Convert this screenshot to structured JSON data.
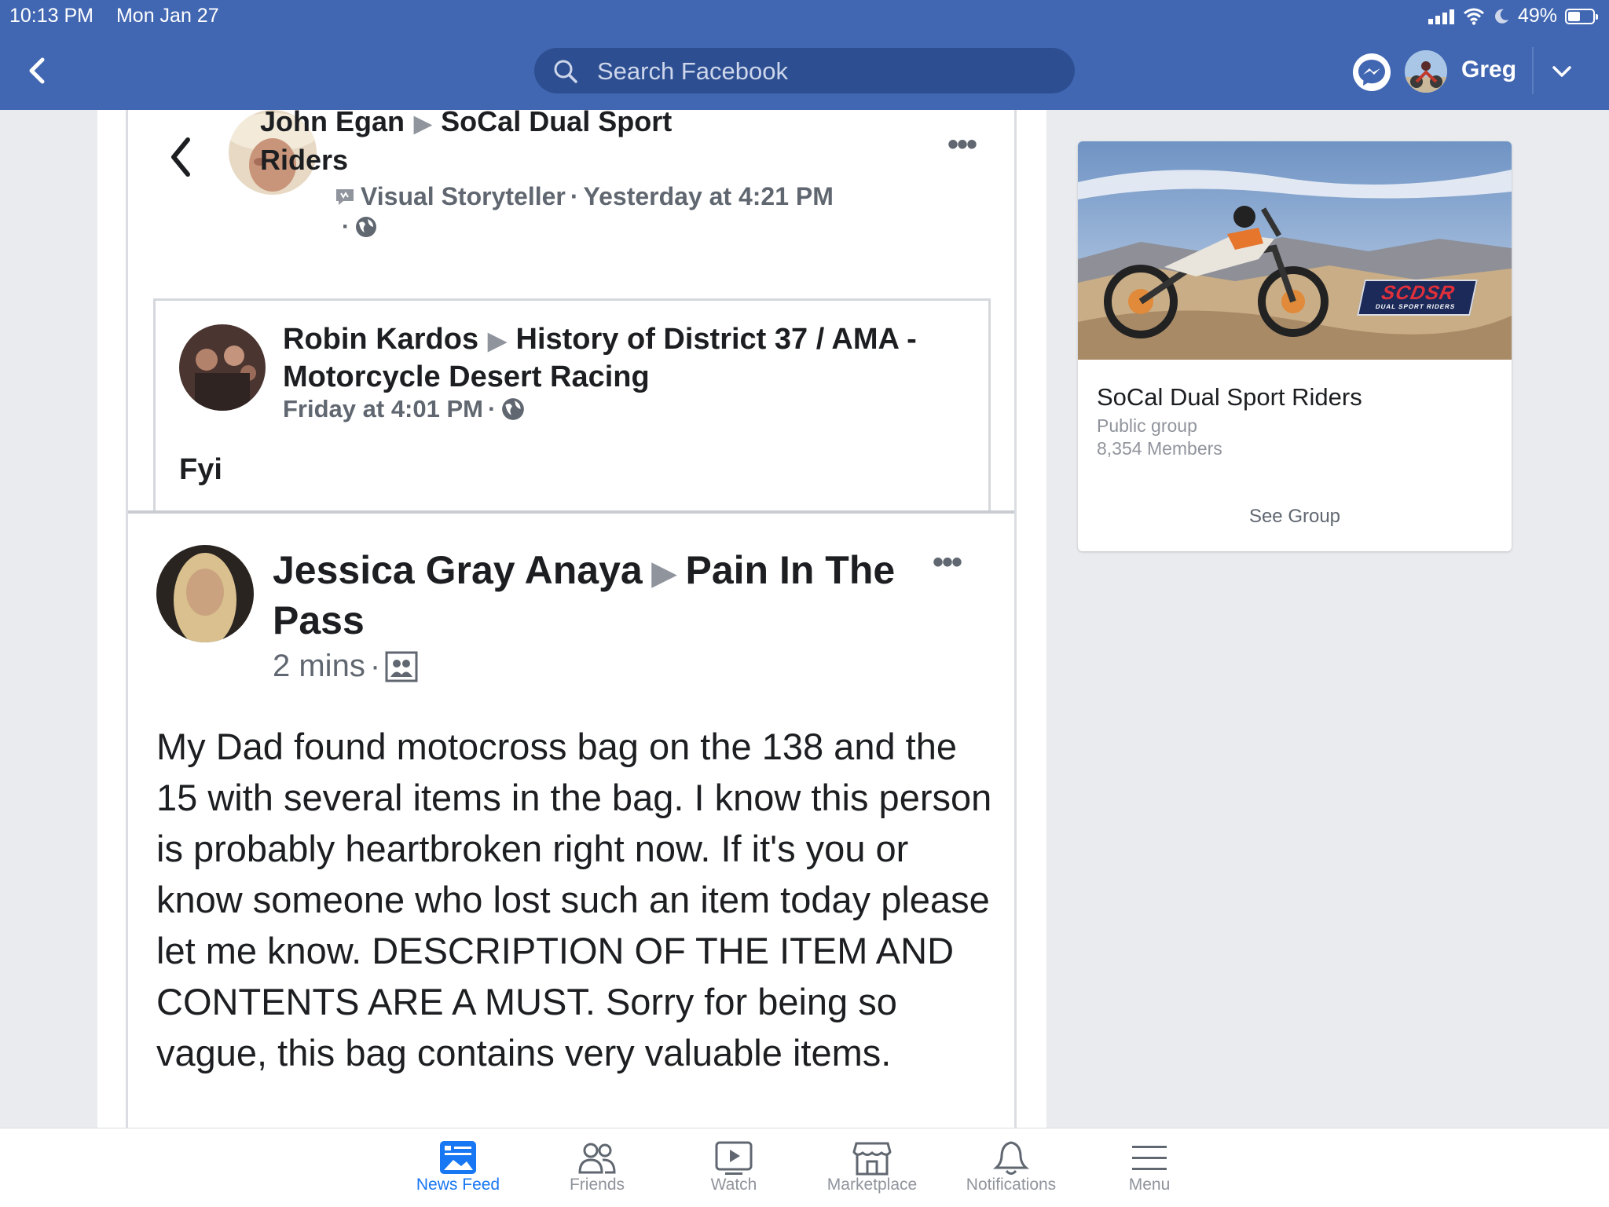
{
  "status_bar": {
    "time": "10:13 PM",
    "date": "Mon Jan 27",
    "battery": "49%",
    "battery_level": 0.49
  },
  "header": {
    "search_placeholder": "Search Facebook",
    "user_name": "Greg"
  },
  "shared_post": {
    "author": "John Egan",
    "group": "SoCal Dual Sport Riders",
    "badge": "Visual Storyteller",
    "time": "Yesterday at 4:21 PM",
    "quoted": {
      "author": "Robin Kardos",
      "group": "History of District 37 / AMA - Motorcycle Desert Racing",
      "time": "Friday at 4:01 PM",
      "text": "Fyi"
    }
  },
  "post": {
    "author": "Jessica Gray Anaya",
    "group": "Pain In The Pass",
    "time": "2 mins",
    "text": "My Dad found motocross bag on the 138 and the 15 with several items in the bag. I know this person is probably heartbroken right now. If it's you or know someone who lost such an item today please let me know.  DESCRIPTION OF THE ITEM AND CONTENTS ARE A MUST. Sorry for being so vague, this bag contains very valuable items."
  },
  "group_card": {
    "name": "SoCal Dual Sport Riders",
    "type": "Public group",
    "members": "8,354 Members",
    "button": "See Group",
    "logo_text": "SCDSR",
    "logo_sub": "DUAL SPORT RIDERS"
  },
  "tabs": [
    {
      "label": "News Feed",
      "icon": "news-feed-icon",
      "active": true
    },
    {
      "label": "Friends",
      "icon": "friends-icon"
    },
    {
      "label": "Watch",
      "icon": "watch-icon"
    },
    {
      "label": "Marketplace",
      "icon": "marketplace-icon"
    },
    {
      "label": "Notifications",
      "icon": "notifications-icon"
    },
    {
      "label": "Menu",
      "icon": "menu-icon"
    }
  ],
  "colors": {
    "brand": "#4267b2",
    "active_tab": "#1877f2",
    "background": "#e9ebee"
  }
}
